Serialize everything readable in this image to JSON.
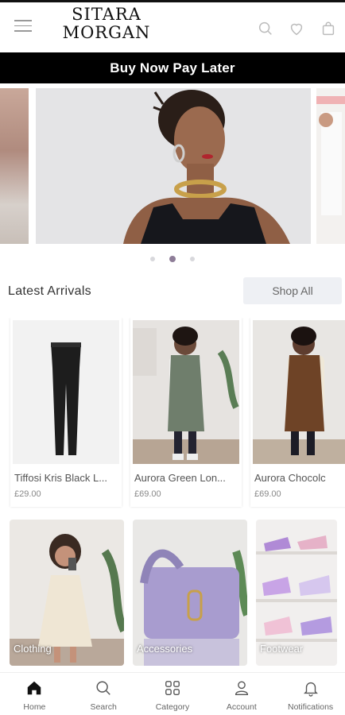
{
  "header": {
    "logo_line1": "SITARA",
    "logo_line2": "MORGAN"
  },
  "banner": {
    "text": "Buy Now Pay Later"
  },
  "carousel": {
    "slides": 3,
    "active_index": 1
  },
  "latest": {
    "title": "Latest Arrivals",
    "shop_all_label": "Shop All",
    "products": [
      {
        "name": "Tiffosi Kris Black L...",
        "price": "£29.00"
      },
      {
        "name": "Aurora Green Lon...",
        "price": "£69.00"
      },
      {
        "name": "Aurora Chocolc",
        "price": "£69.00"
      }
    ]
  },
  "categories": [
    {
      "label": "Clothing"
    },
    {
      "label": "Accessories"
    },
    {
      "label": "Footwear"
    }
  ],
  "nav": {
    "items": [
      {
        "label": "Home",
        "icon": "home-icon"
      },
      {
        "label": "Search",
        "icon": "search-icon"
      },
      {
        "label": "Category",
        "icon": "grid-icon"
      },
      {
        "label": "Account",
        "icon": "user-icon"
      },
      {
        "label": "Notifications",
        "icon": "bell-icon"
      }
    ]
  },
  "colors": {
    "banner_bg": "#000000",
    "accent_dot": "#8e7d98",
    "shop_all_bg": "#eef0f4"
  }
}
